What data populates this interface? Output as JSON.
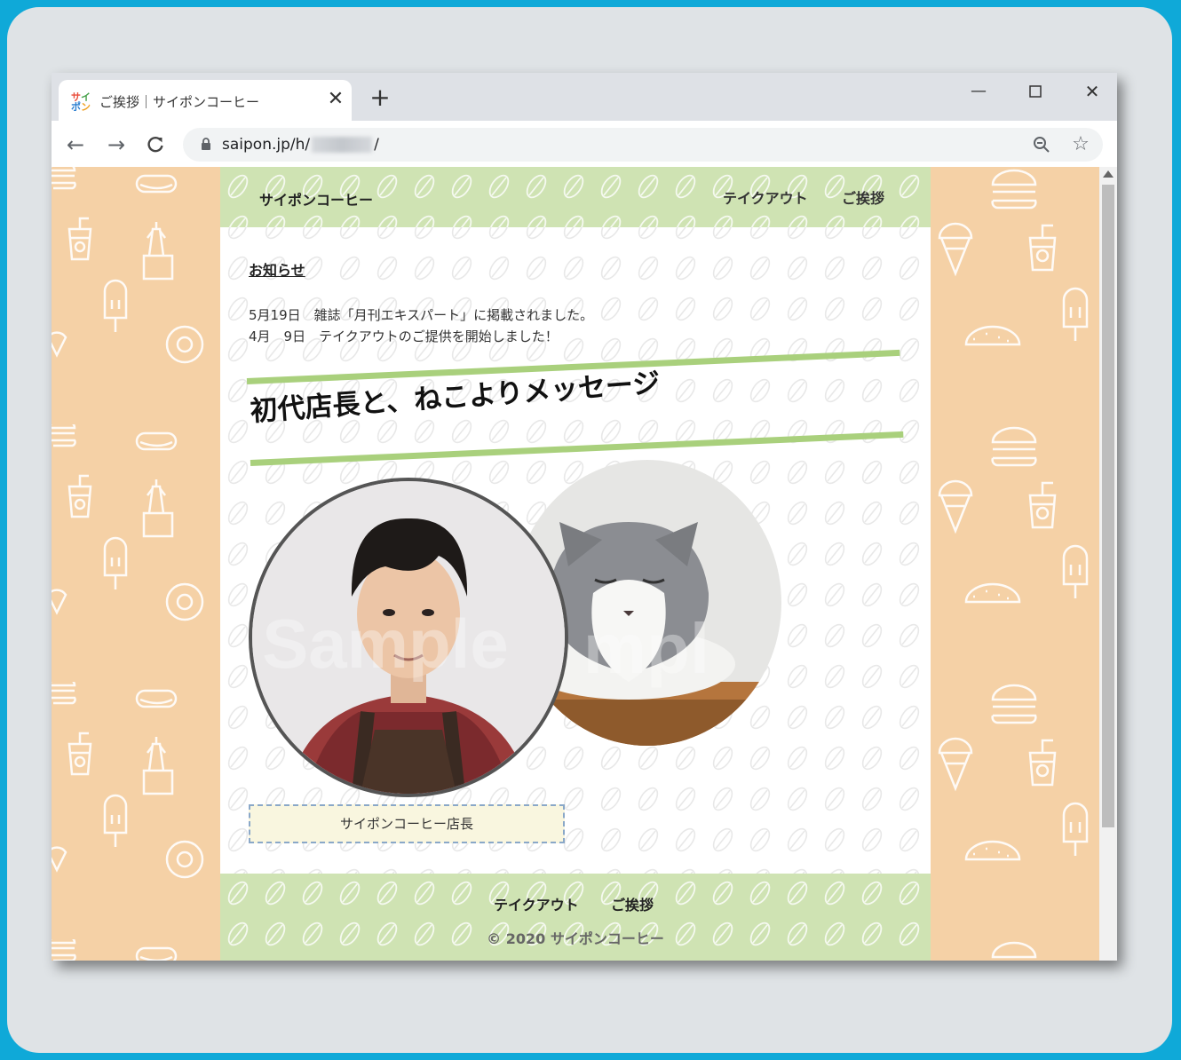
{
  "browser": {
    "tab_title": "ご挨拶｜サイポンコーヒー",
    "favicon_text": "サイポン",
    "new_tab": "+",
    "tab_close": "✕",
    "win_minimize": "—",
    "win_maximize": "☐",
    "win_close": "✕",
    "back": "←",
    "forward": "→",
    "reload": "C",
    "url_host": "saipon.jp/h/",
    "url_suffix": "/",
    "star": "☆"
  },
  "site": {
    "brand": "サイポンコーヒー",
    "nav": [
      "テイクアウト",
      "ご挨拶"
    ],
    "news_heading": "お知らせ",
    "news": [
      "5月19日　雑誌「月刊エキスパート」に掲載されました。",
      "4月　9日　テイクアウトのご提供を開始しました！"
    ],
    "headline": "初代店長と、ねこよりメッセージ",
    "watermark": "Sample",
    "caption": "サイポンコーヒー店長",
    "footer_nav": [
      "テイクアウト",
      "ご挨拶"
    ],
    "copyright": "© 2020 サイポンコーヒー"
  },
  "colors": {
    "outer_frame": "#0fa9d8",
    "side_bg": "#f5d1a6",
    "header_green": "#cfe3b3",
    "stripe_green": "#a9d07c",
    "caption_bg": "#f9f6df"
  }
}
